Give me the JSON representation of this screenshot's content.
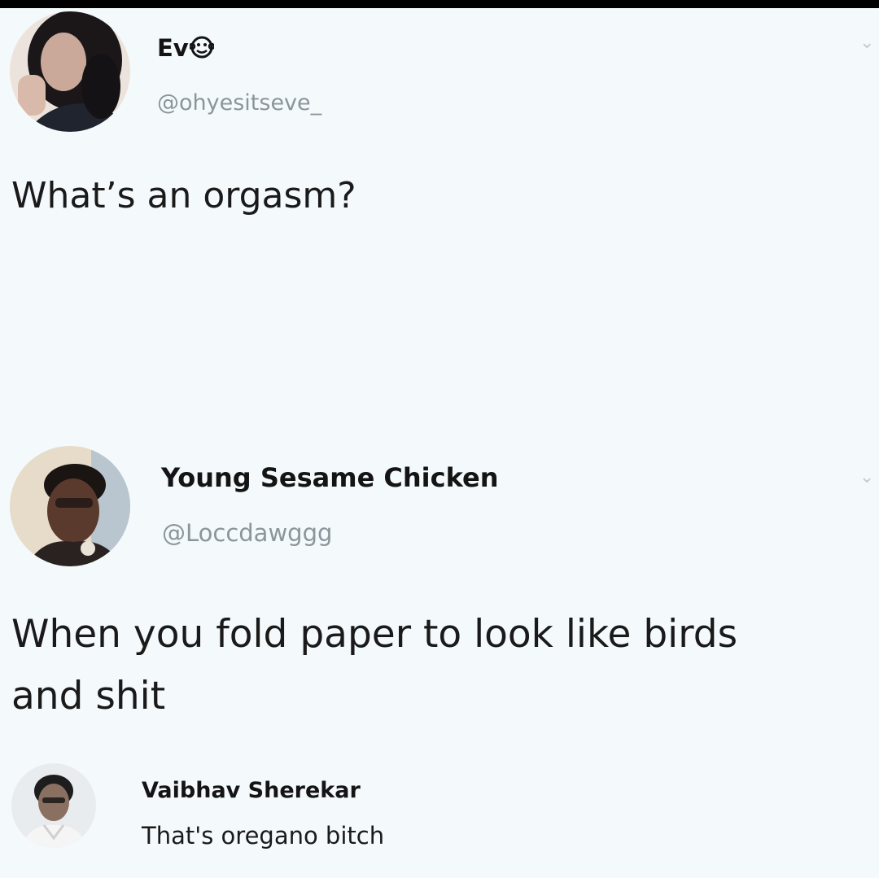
{
  "tweets": [
    {
      "display_name": "Ev",
      "name_icon": "monkey-face-icon",
      "handle": "@ohyesitseve_",
      "text_lines": [
        "What’s an orgasm?"
      ]
    },
    {
      "display_name": "Young Sesame Chicken",
      "handle": "@Loccdawggg",
      "text_lines": [
        "When you fold paper to look like birds",
        "and shit"
      ]
    }
  ],
  "comment": {
    "display_name": "Vaibhav Sherekar",
    "text": "That's oregano bitch"
  },
  "colors": {
    "background": "#f4f9fb",
    "name": "#141414",
    "handle": "#8c959c",
    "text": "#1a1a1a"
  }
}
